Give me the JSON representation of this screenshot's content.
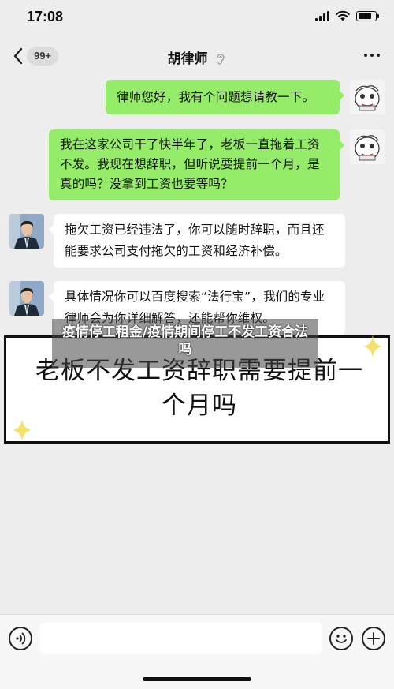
{
  "status_bar": {
    "time": "17:08",
    "battery_level": 0.8
  },
  "nav": {
    "unread_count": "99+",
    "title": "胡律师",
    "ear_icon": "hearing-icon",
    "more_icon": "more-dots-icon"
  },
  "messages": [
    {
      "side": "sent",
      "text": "律师您好，我有个问题想请教一下。"
    },
    {
      "side": "sent",
      "text": "我在这家公司干了快半年了，老板一直拖着工资不发。我现在想辞职，但听说要提前一个月，是真的吗？没拿到工资也要等吗？"
    },
    {
      "side": "received",
      "text": "拖欠工资已经违法了，你可以随时辞职，而且还能要求公司支付拖欠的工资和经济补偿。"
    },
    {
      "side": "received",
      "text": "具体情况你可以百度搜索“法行宝”，我们的专业律师会为你详细解答，还能帮你维权。"
    }
  ],
  "overlay_title": "疫情停工租金/疫情期间停工不发工资合法吗",
  "caption": "老板不发工资辞职需要提前一个月吗",
  "input_bar": {
    "voice_icon": "voice-icon",
    "emoji_icon": "emoji-icon",
    "plus_icon": "plus-icon",
    "input_value": ""
  },
  "colors": {
    "sent_bubble": "#95ec69",
    "received_bubble": "#ffffff",
    "background": "#ededed",
    "sparkle": "#f5e16a"
  }
}
